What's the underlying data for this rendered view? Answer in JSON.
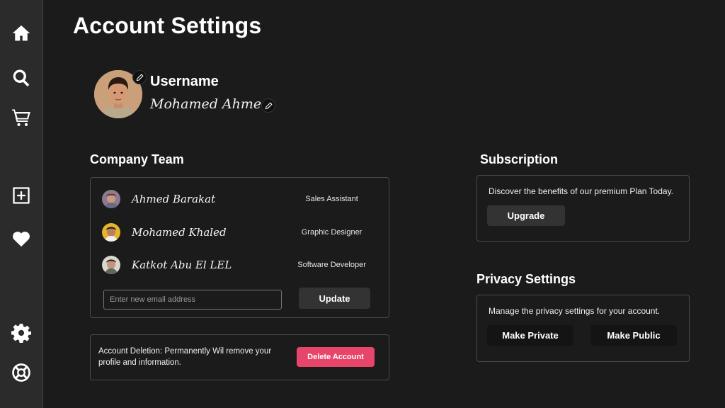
{
  "page": {
    "title": "Account Settings"
  },
  "sidebar": {
    "top_icons": [
      "home-icon",
      "search-icon",
      "cart-icon"
    ],
    "middle_icons": [
      "add-square-icon",
      "heart-icon"
    ],
    "bottom_icons": [
      "gear-icon",
      "lifebuoy-icon"
    ]
  },
  "profile": {
    "username_label": "Username",
    "username_value": "Mohamed Ahmed"
  },
  "team": {
    "title": "Company Team",
    "members": [
      {
        "name": "Ahmed Barakat",
        "role": "Sales Assistant"
      },
      {
        "name": "Mohamed Khaled",
        "role": "Graphic Designer"
      },
      {
        "name": "Katkot Abu El LEL",
        "role": "Software Developer"
      }
    ],
    "email_placeholder": "Enter new email address",
    "update_label": "Update"
  },
  "deletion": {
    "text": "Account Deletion: Permanently Wil remove your profile and information.",
    "button_label": "Delete Account"
  },
  "subscription": {
    "title": "Subscription",
    "text": "Discover the benefits of our premium Plan Today.",
    "button_label": "Upgrade"
  },
  "privacy": {
    "title": "Privacy Settings",
    "text": "Manage the privacy settings for your account.",
    "private_label": "Make Private",
    "public_label": "Make Public"
  },
  "colors": {
    "background": "#1b1b1b",
    "sidebar": "#2b2b2b",
    "danger": "#e8456a",
    "button": "#333333"
  }
}
